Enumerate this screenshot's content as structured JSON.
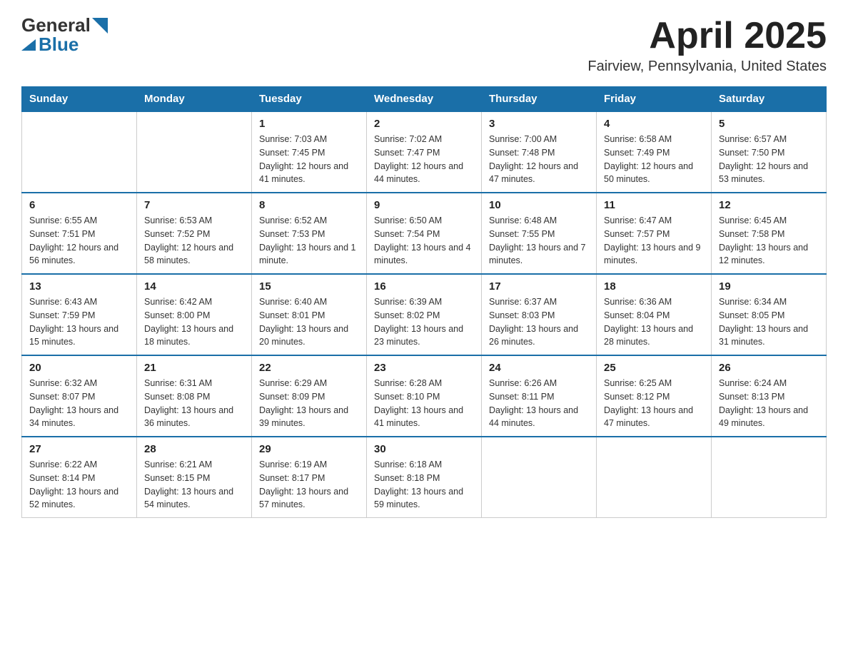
{
  "header": {
    "logo_general": "General",
    "logo_blue": "Blue",
    "title": "April 2025",
    "location": "Fairview, Pennsylvania, United States"
  },
  "weekdays": [
    "Sunday",
    "Monday",
    "Tuesday",
    "Wednesday",
    "Thursday",
    "Friday",
    "Saturday"
  ],
  "weeks": [
    [
      {
        "day": "",
        "info": ""
      },
      {
        "day": "",
        "info": ""
      },
      {
        "day": "1",
        "info": "Sunrise: 7:03 AM\nSunset: 7:45 PM\nDaylight: 12 hours\nand 41 minutes."
      },
      {
        "day": "2",
        "info": "Sunrise: 7:02 AM\nSunset: 7:47 PM\nDaylight: 12 hours\nand 44 minutes."
      },
      {
        "day": "3",
        "info": "Sunrise: 7:00 AM\nSunset: 7:48 PM\nDaylight: 12 hours\nand 47 minutes."
      },
      {
        "day": "4",
        "info": "Sunrise: 6:58 AM\nSunset: 7:49 PM\nDaylight: 12 hours\nand 50 minutes."
      },
      {
        "day": "5",
        "info": "Sunrise: 6:57 AM\nSunset: 7:50 PM\nDaylight: 12 hours\nand 53 minutes."
      }
    ],
    [
      {
        "day": "6",
        "info": "Sunrise: 6:55 AM\nSunset: 7:51 PM\nDaylight: 12 hours\nand 56 minutes."
      },
      {
        "day": "7",
        "info": "Sunrise: 6:53 AM\nSunset: 7:52 PM\nDaylight: 12 hours\nand 58 minutes."
      },
      {
        "day": "8",
        "info": "Sunrise: 6:52 AM\nSunset: 7:53 PM\nDaylight: 13 hours\nand 1 minute."
      },
      {
        "day": "9",
        "info": "Sunrise: 6:50 AM\nSunset: 7:54 PM\nDaylight: 13 hours\nand 4 minutes."
      },
      {
        "day": "10",
        "info": "Sunrise: 6:48 AM\nSunset: 7:55 PM\nDaylight: 13 hours\nand 7 minutes."
      },
      {
        "day": "11",
        "info": "Sunrise: 6:47 AM\nSunset: 7:57 PM\nDaylight: 13 hours\nand 9 minutes."
      },
      {
        "day": "12",
        "info": "Sunrise: 6:45 AM\nSunset: 7:58 PM\nDaylight: 13 hours\nand 12 minutes."
      }
    ],
    [
      {
        "day": "13",
        "info": "Sunrise: 6:43 AM\nSunset: 7:59 PM\nDaylight: 13 hours\nand 15 minutes."
      },
      {
        "day": "14",
        "info": "Sunrise: 6:42 AM\nSunset: 8:00 PM\nDaylight: 13 hours\nand 18 minutes."
      },
      {
        "day": "15",
        "info": "Sunrise: 6:40 AM\nSunset: 8:01 PM\nDaylight: 13 hours\nand 20 minutes."
      },
      {
        "day": "16",
        "info": "Sunrise: 6:39 AM\nSunset: 8:02 PM\nDaylight: 13 hours\nand 23 minutes."
      },
      {
        "day": "17",
        "info": "Sunrise: 6:37 AM\nSunset: 8:03 PM\nDaylight: 13 hours\nand 26 minutes."
      },
      {
        "day": "18",
        "info": "Sunrise: 6:36 AM\nSunset: 8:04 PM\nDaylight: 13 hours\nand 28 minutes."
      },
      {
        "day": "19",
        "info": "Sunrise: 6:34 AM\nSunset: 8:05 PM\nDaylight: 13 hours\nand 31 minutes."
      }
    ],
    [
      {
        "day": "20",
        "info": "Sunrise: 6:32 AM\nSunset: 8:07 PM\nDaylight: 13 hours\nand 34 minutes."
      },
      {
        "day": "21",
        "info": "Sunrise: 6:31 AM\nSunset: 8:08 PM\nDaylight: 13 hours\nand 36 minutes."
      },
      {
        "day": "22",
        "info": "Sunrise: 6:29 AM\nSunset: 8:09 PM\nDaylight: 13 hours\nand 39 minutes."
      },
      {
        "day": "23",
        "info": "Sunrise: 6:28 AM\nSunset: 8:10 PM\nDaylight: 13 hours\nand 41 minutes."
      },
      {
        "day": "24",
        "info": "Sunrise: 6:26 AM\nSunset: 8:11 PM\nDaylight: 13 hours\nand 44 minutes."
      },
      {
        "day": "25",
        "info": "Sunrise: 6:25 AM\nSunset: 8:12 PM\nDaylight: 13 hours\nand 47 minutes."
      },
      {
        "day": "26",
        "info": "Sunrise: 6:24 AM\nSunset: 8:13 PM\nDaylight: 13 hours\nand 49 minutes."
      }
    ],
    [
      {
        "day": "27",
        "info": "Sunrise: 6:22 AM\nSunset: 8:14 PM\nDaylight: 13 hours\nand 52 minutes."
      },
      {
        "day": "28",
        "info": "Sunrise: 6:21 AM\nSunset: 8:15 PM\nDaylight: 13 hours\nand 54 minutes."
      },
      {
        "day": "29",
        "info": "Sunrise: 6:19 AM\nSunset: 8:17 PM\nDaylight: 13 hours\nand 57 minutes."
      },
      {
        "day": "30",
        "info": "Sunrise: 6:18 AM\nSunset: 8:18 PM\nDaylight: 13 hours\nand 59 minutes."
      },
      {
        "day": "",
        "info": ""
      },
      {
        "day": "",
        "info": ""
      },
      {
        "day": "",
        "info": ""
      }
    ]
  ]
}
